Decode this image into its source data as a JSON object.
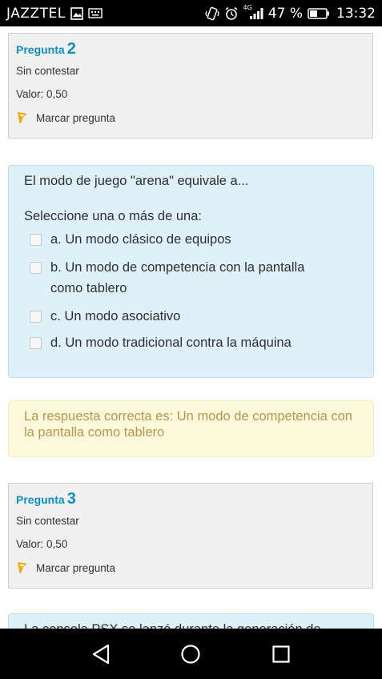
{
  "status_bar": {
    "carrier": "JAZZTEL",
    "network": "4G",
    "battery": "47 %",
    "time": "13:32",
    "icons": [
      "gallery-icon",
      "keyboard-icon",
      "vibrate-icon",
      "alarm-icon",
      "signal-icon",
      "battery-icon"
    ]
  },
  "question2": {
    "label": "Pregunta",
    "number": "2",
    "status": "Sin contestar",
    "value": "Valor: 0,50",
    "flag_label": "Marcar pregunta"
  },
  "question2_body": {
    "text": "El modo de juego \"arena\" equivale a...",
    "prompt": "Seleccione una o más de una:",
    "options": [
      {
        "label": "a. Un modo clásico de equipos",
        "checked": false
      },
      {
        "label": "b. Un modo de competencia con la pantalla como tablero",
        "checked": false
      },
      {
        "label": "c. Un modo asociativo",
        "checked": false
      },
      {
        "label": "d. Un modo tradicional contra la máquina",
        "checked": false
      }
    ]
  },
  "feedback": {
    "text": "La respuesta correcta es: Un modo de competencia con la pantalla como tablero"
  },
  "question3": {
    "label": "Pregunta",
    "number": "3",
    "status": "Sin contestar",
    "value": "Valor: 0,50",
    "flag_label": "Marcar pregunta"
  },
  "question3_body": {
    "text_partial": "La consola PSX se lanzó durante la generación de"
  },
  "colors": {
    "accent": "#0f8fbf",
    "question_bg": "#def0f8",
    "feedback_bg": "#fcf8dc",
    "feedback_text": "#b8964b",
    "flag": "#f0a800"
  },
  "nav": {
    "icons": [
      "back-icon",
      "home-icon",
      "recents-icon"
    ]
  }
}
